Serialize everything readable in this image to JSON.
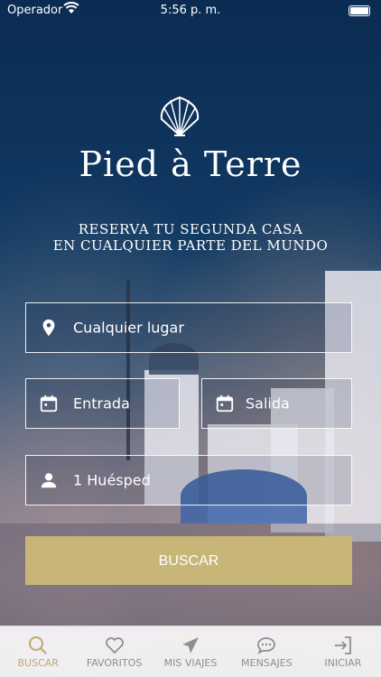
{
  "status": {
    "carrier": "Operador",
    "time": "5:56 p. m."
  },
  "brand": {
    "name": "Pied à Terre",
    "tagline_line1": "RESERVA TU SEGUNDA CASA",
    "tagline_line2": "EN CUALQUIER PARTE DEL MUNDO"
  },
  "form": {
    "location_placeholder": "Cualquier lugar",
    "checkin_label": "Entrada",
    "checkout_label": "Salida",
    "guests_label": "1 Huésped",
    "search_label": "BUSCAR"
  },
  "tabs": [
    {
      "label": "BUSCAR",
      "icon": "search-icon",
      "active": true
    },
    {
      "label": "FAVORITOS",
      "icon": "heart-icon",
      "active": false
    },
    {
      "label": "MIS VIAJES",
      "icon": "airplane-icon",
      "active": false
    },
    {
      "label": "MENSAJES",
      "icon": "chat-icon",
      "active": false
    },
    {
      "label": "INICIAR",
      "icon": "login-icon",
      "active": false
    }
  ],
  "colors": {
    "accent": "#c7b677",
    "tab_active": "#bfa873",
    "tab_inactive": "#8e8e96"
  }
}
